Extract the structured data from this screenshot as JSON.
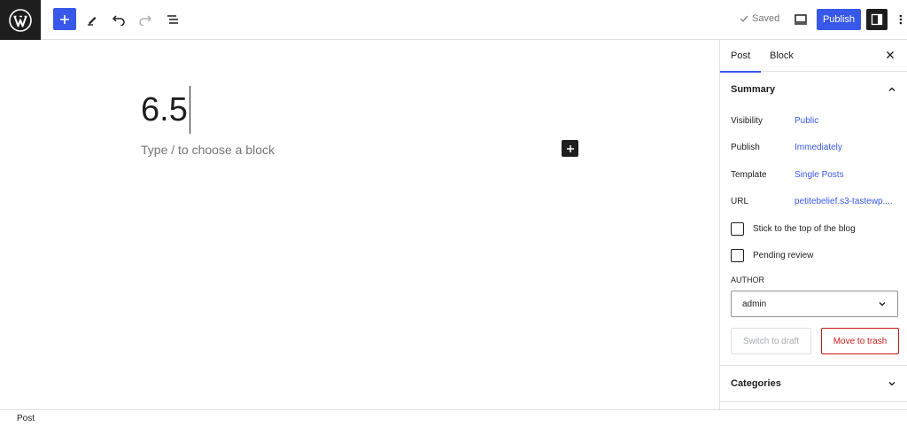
{
  "toolbar": {
    "saved_label": "Saved",
    "publish_label": "Publish"
  },
  "editor": {
    "title": "6.5",
    "placeholder": "Type / to choose a block"
  },
  "sidebar": {
    "tabs": [
      {
        "label": "Post",
        "active": true
      },
      {
        "label": "Block",
        "active": false
      }
    ],
    "summary": {
      "heading": "Summary",
      "rows": [
        {
          "label": "Visibility",
          "value": "Public"
        },
        {
          "label": "Publish",
          "value": "Immediately"
        },
        {
          "label": "Template",
          "value": "Single Posts"
        },
        {
          "label": "URL",
          "value": "petitebelief.s3-tastewp...."
        }
      ],
      "checkboxes": [
        {
          "label": "Stick to the top of the blog",
          "checked": false
        },
        {
          "label": "Pending review",
          "checked": false
        }
      ],
      "author_label": "AUTHOR",
      "author_value": "admin",
      "switch_draft_label": "Switch to draft",
      "trash_label": "Move to trash"
    },
    "categories_heading": "Categories"
  },
  "footer": {
    "breadcrumb": "Post"
  },
  "colors": {
    "accent": "#3858e9",
    "dark": "#1e1e1e",
    "danger": "#cc1818",
    "border": "#e0e0e0",
    "muted": "#757575"
  }
}
